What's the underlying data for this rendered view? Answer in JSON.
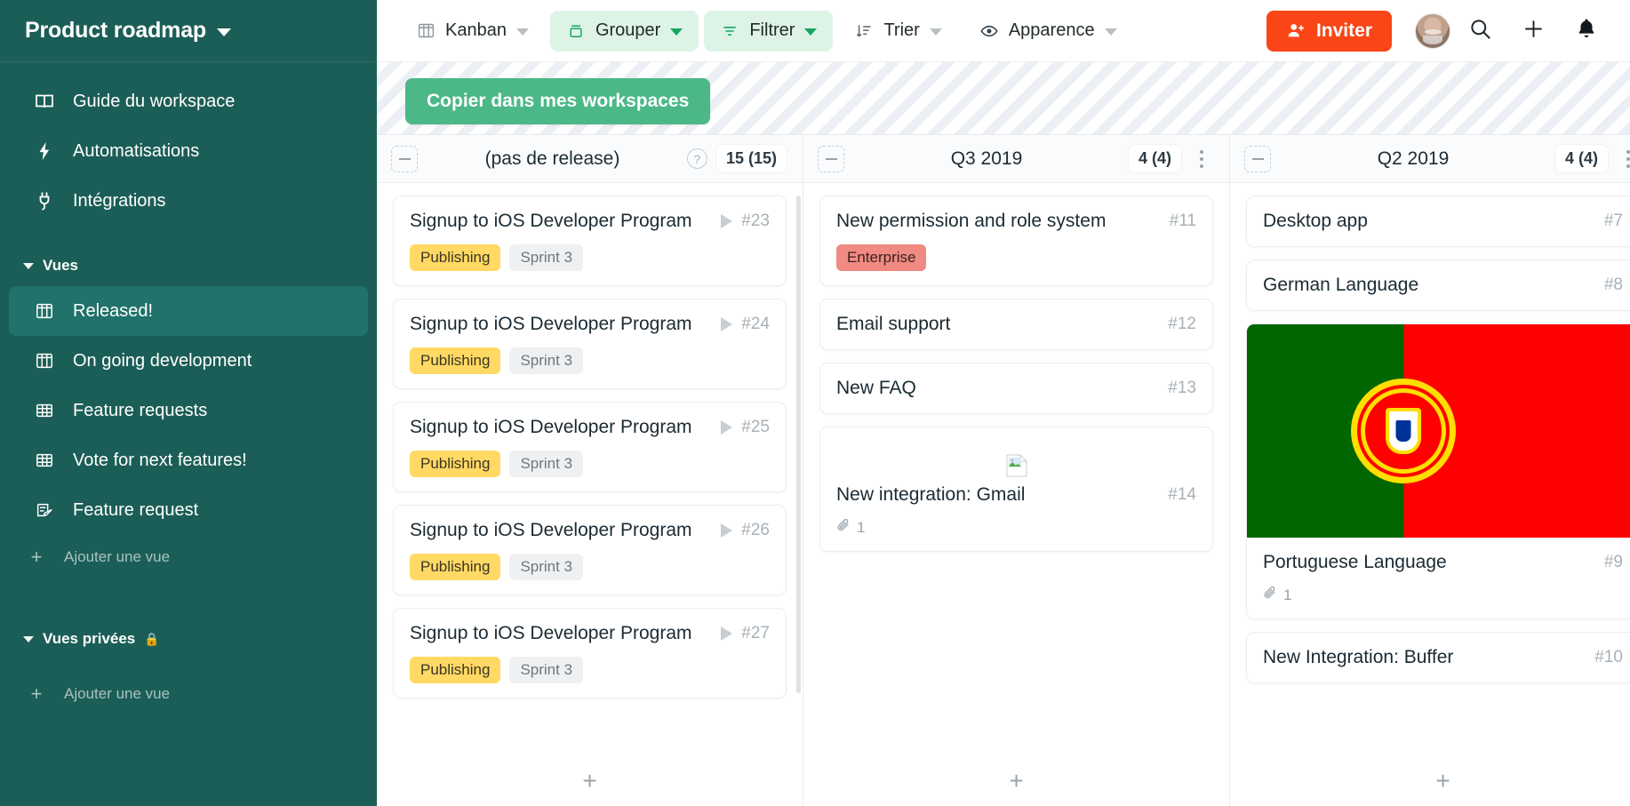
{
  "sidebar": {
    "workspace_title": "Product roadmap",
    "nav": [
      {
        "label": "Guide du workspace",
        "icon": "book-icon"
      },
      {
        "label": "Automatisations",
        "icon": "bolt-icon"
      },
      {
        "label": "Intégrations",
        "icon": "plug-icon"
      }
    ],
    "views_section": {
      "title": "Vues"
    },
    "views": [
      {
        "label": "Released!",
        "icon": "kanban-icon",
        "active": true
      },
      {
        "label": "On going development",
        "icon": "kanban-icon",
        "active": false
      },
      {
        "label": "Feature requests",
        "icon": "table-icon",
        "active": false
      },
      {
        "label": "Vote for next features!",
        "icon": "table-icon",
        "active": false
      },
      {
        "label": "Feature request",
        "icon": "form-icon",
        "active": false
      }
    ],
    "add_view_label": "Ajouter une vue",
    "private_section": {
      "title": "Vues privées",
      "lock": "🔒"
    },
    "private_add_view_label": "Ajouter une vue"
  },
  "toolbar": {
    "view_type": "Kanban",
    "group": "Grouper",
    "filter": "Filtrer",
    "sort": "Trier",
    "appearance": "Apparence",
    "invite": "Inviter",
    "icons": {
      "kanban": "kanban-icon",
      "group": "group-icon",
      "filter": "filter-icon",
      "sort": "sort-icon",
      "appearance": "eye-icon",
      "invite": "user-plus-icon",
      "search": "search-icon",
      "add": "plus-icon",
      "bell": "bell-icon"
    },
    "accent_color": "#fa4616",
    "chip_color": "#ddf3e6"
  },
  "banner": {
    "copy_label": "Copier dans mes workspaces",
    "color": "#4cb887"
  },
  "board": {
    "add_card_label": "+",
    "columns": [
      {
        "title": "(pas de release)",
        "count": "15 (15)",
        "has_help": true,
        "has_kebab": false,
        "cards": [
          {
            "title": "Signup to iOS Developer Program",
            "num": "#23",
            "play": true,
            "tags": [
              {
                "text": "Publishing",
                "style": "yellow"
              },
              {
                "text": "Sprint 3",
                "style": "grey"
              }
            ]
          },
          {
            "title": "Signup to iOS Developer Program",
            "num": "#24",
            "play": true,
            "tags": [
              {
                "text": "Publishing",
                "style": "yellow"
              },
              {
                "text": "Sprint 3",
                "style": "grey"
              }
            ]
          },
          {
            "title": "Signup to iOS Developer Program",
            "num": "#25",
            "play": true,
            "tags": [
              {
                "text": "Publishing",
                "style": "yellow"
              },
              {
                "text": "Sprint 3",
                "style": "grey"
              }
            ]
          },
          {
            "title": "Signup to iOS Developer Program",
            "num": "#26",
            "play": true,
            "tags": [
              {
                "text": "Publishing",
                "style": "yellow"
              },
              {
                "text": "Sprint 3",
                "style": "grey"
              }
            ]
          },
          {
            "title": "Signup to iOS Developer Program",
            "num": "#27",
            "play": true,
            "tags": [
              {
                "text": "Publishing",
                "style": "yellow"
              },
              {
                "text": "Sprint 3",
                "style": "grey"
              }
            ]
          }
        ]
      },
      {
        "title": "Q3 2019",
        "count": "4 (4)",
        "has_help": false,
        "has_kebab": true,
        "cards": [
          {
            "title": "New permission and role system",
            "num": "#11",
            "play": false,
            "tags": [
              {
                "text": "Enterprise",
                "style": "red"
              }
            ]
          },
          {
            "title": "Email support",
            "num": "#12",
            "play": false,
            "tags": []
          },
          {
            "title": "New FAQ",
            "num": "#13",
            "play": false,
            "tags": []
          },
          {
            "title": "New integration: Gmail",
            "num": "#14",
            "play": false,
            "tags": [],
            "broken_image": true,
            "attachments": "1"
          }
        ]
      },
      {
        "title": "Q2 2019",
        "count": "4 (4)",
        "has_help": false,
        "has_kebab": true,
        "cards": [
          {
            "title": "Desktop app",
            "num": "#7",
            "play": false,
            "tags": []
          },
          {
            "title": "German Language",
            "num": "#8",
            "play": false,
            "tags": []
          },
          {
            "title": "Portuguese Language",
            "num": "#9",
            "play": false,
            "tags": [],
            "cover_image": "portugal-flag",
            "attachments": "1"
          },
          {
            "title": "New Integration: Buffer",
            "num": "#10",
            "play": false,
            "tags": []
          }
        ]
      }
    ]
  }
}
